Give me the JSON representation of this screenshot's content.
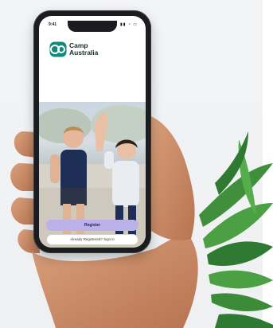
{
  "app": {
    "status_time": "9:41",
    "status_icons": "▮▮ ◔ ▭",
    "logo_line1": "Camp",
    "logo_line2": "Australia"
  },
  "actions": {
    "primary_label": "Register",
    "secondary_label": "Already Registered? Sign in"
  },
  "colors": {
    "brand_teal": "#0f8a7d",
    "primary_button": "#b9b1e8",
    "phone_frame": "#1b1c1f"
  }
}
